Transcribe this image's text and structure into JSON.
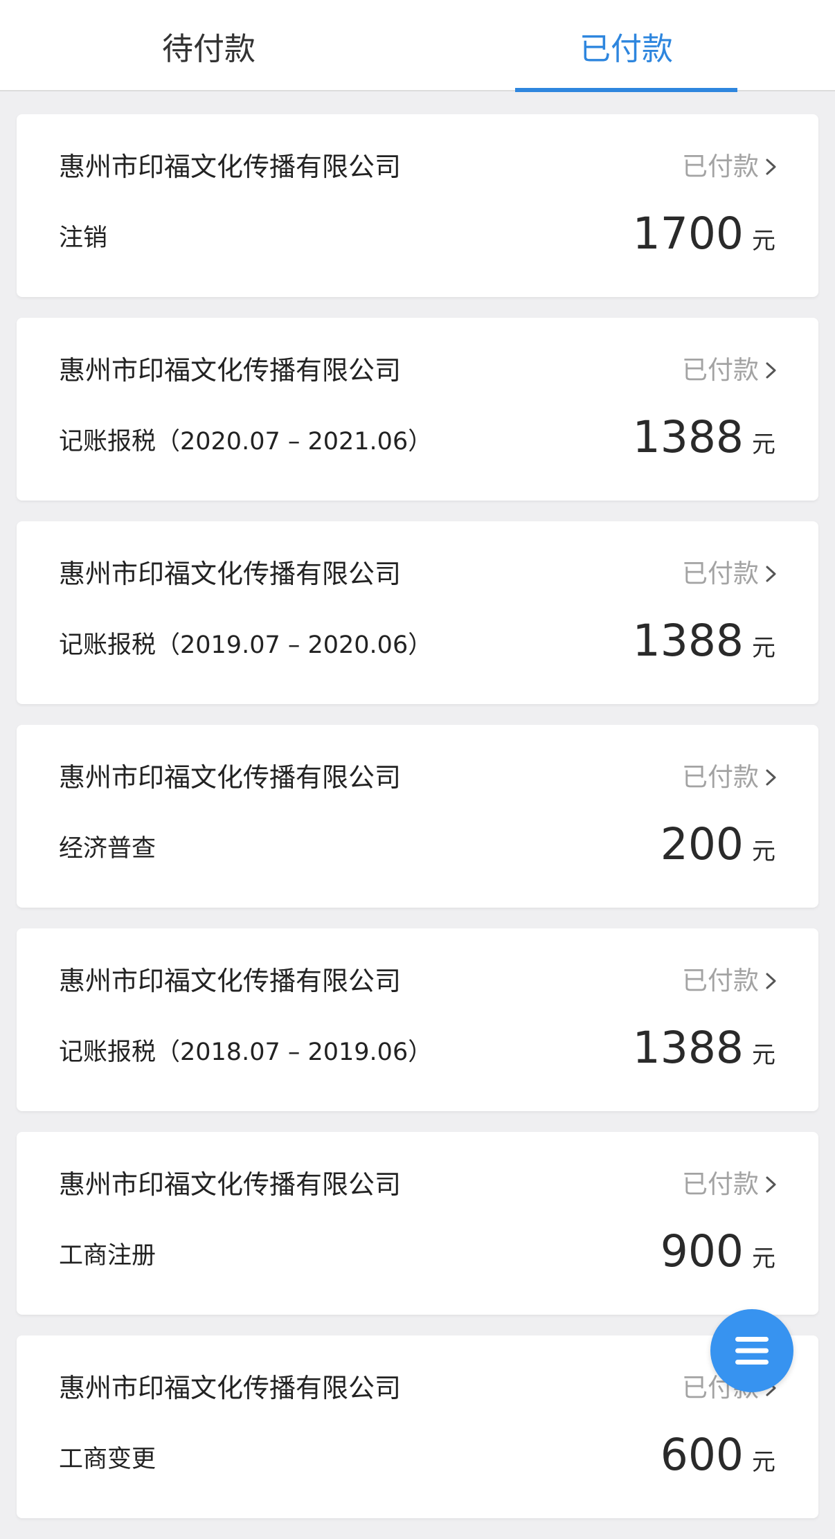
{
  "tabs": [
    {
      "label": "待付款",
      "active": false
    },
    {
      "label": "已付款",
      "active": true
    }
  ],
  "colors": {
    "accent": "#2e86de",
    "fab": "#3793f0",
    "background": "#efeff1",
    "status_text": "#a3a3a3"
  },
  "orders": [
    {
      "company": "惠州市印福文化传播有限公司",
      "status": "已付款",
      "service": "注销",
      "amount": "1700",
      "unit": "元"
    },
    {
      "company": "惠州市印福文化传播有限公司",
      "status": "已付款",
      "service": "记账报税（2020.07 – 2021.06）",
      "amount": "1388",
      "unit": "元"
    },
    {
      "company": "惠州市印福文化传播有限公司",
      "status": "已付款",
      "service": "记账报税（2019.07 – 2020.06）",
      "amount": "1388",
      "unit": "元"
    },
    {
      "company": "惠州市印福文化传播有限公司",
      "status": "已付款",
      "service": "经济普查",
      "amount": "200",
      "unit": "元"
    },
    {
      "company": "惠州市印福文化传播有限公司",
      "status": "已付款",
      "service": "记账报税（2018.07 – 2019.06）",
      "amount": "1388",
      "unit": "元"
    },
    {
      "company": "惠州市印福文化传播有限公司",
      "status": "已付款",
      "service": "工商注册",
      "amount": "900",
      "unit": "元"
    },
    {
      "company": "惠州市印福文化传播有限公司",
      "status": "已付款",
      "service": "工商变更",
      "amount": "600",
      "unit": "元"
    }
  ],
  "fab": {
    "icon": "menu-icon"
  }
}
